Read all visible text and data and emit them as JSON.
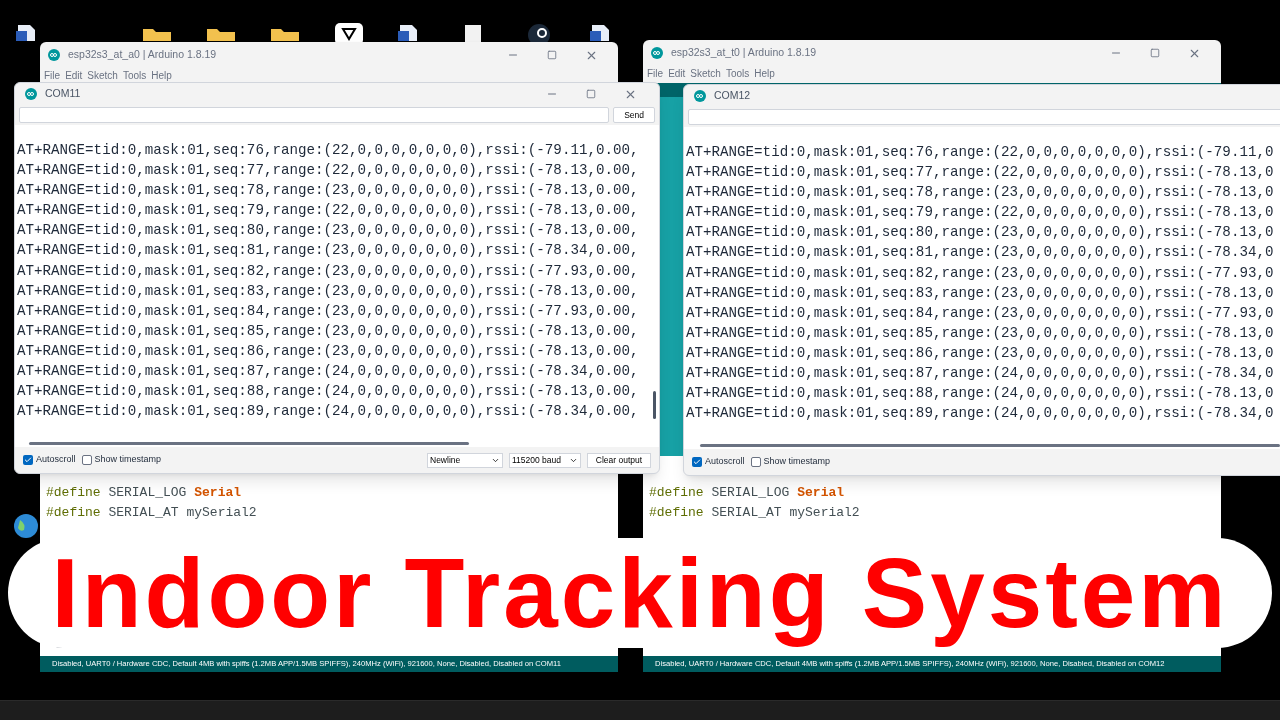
{
  "ide_windows": [
    {
      "title": "esp32s3_at_a0 | Arduino 1.8.19",
      "menu": [
        "File",
        "Edit",
        "Sketch",
        "Tools",
        "Help"
      ],
      "code": [
        [
          {
            "text": "#define",
            "kind": "directive"
          },
          {
            "text": " SERIAL_LOG ",
            "kind": "plain"
          },
          {
            "text": "Serial",
            "kind": "class"
          }
        ],
        [
          {
            "text": "#define",
            "kind": "directive"
          },
          {
            "text": " SERIAL_AT mySerial2",
            "kind": "plain"
          }
        ]
      ],
      "status": "Disabled, UART0 / Hardware CDC, Default 4MB with spiffs (1.2MB APP/1.5MB SPIFFS), 240MHz (WiFi), 921600, None, Disabled, Disabled on COM11"
    },
    {
      "title": "esp32s3_at_t0 | Arduino 1.8.19",
      "menu": [
        "File",
        "Edit",
        "Sketch",
        "Tools",
        "Help"
      ],
      "code": [
        [
          {
            "text": "#define",
            "kind": "directive"
          },
          {
            "text": " SERIAL_LOG ",
            "kind": "plain"
          },
          {
            "text": "Serial",
            "kind": "class"
          }
        ],
        [
          {
            "text": "#define",
            "kind": "directive"
          },
          {
            "text": " SERIAL_AT mySerial2",
            "kind": "plain"
          }
        ]
      ],
      "status": "Disabled, UART0 / Hardware CDC, Default 4MB with spiffs (1.2MB APP/1.5MB SPIFFS), 240MHz (WiFi), 921600, None, Disabled, Disabled on COM12"
    }
  ],
  "monitors": [
    {
      "title": "COM11",
      "send": "Send",
      "lines": [
        "AT+RANGE=tid:0,mask:01,seq:76,range:(22,0,0,0,0,0,0,0),rssi:(-79.11,0.00,",
        "AT+RANGE=tid:0,mask:01,seq:77,range:(22,0,0,0,0,0,0,0),rssi:(-78.13,0.00,",
        "AT+RANGE=tid:0,mask:01,seq:78,range:(23,0,0,0,0,0,0,0),rssi:(-78.13,0.00,",
        "AT+RANGE=tid:0,mask:01,seq:79,range:(22,0,0,0,0,0,0,0),rssi:(-78.13,0.00,",
        "AT+RANGE=tid:0,mask:01,seq:80,range:(23,0,0,0,0,0,0,0),rssi:(-78.13,0.00,",
        "AT+RANGE=tid:0,mask:01,seq:81,range:(23,0,0,0,0,0,0,0),rssi:(-78.34,0.00,",
        "AT+RANGE=tid:0,mask:01,seq:82,range:(23,0,0,0,0,0,0,0),rssi:(-77.93,0.00,",
        "AT+RANGE=tid:0,mask:01,seq:83,range:(23,0,0,0,0,0,0,0),rssi:(-78.13,0.00,",
        "AT+RANGE=tid:0,mask:01,seq:84,range:(23,0,0,0,0,0,0,0),rssi:(-77.93,0.00,",
        "AT+RANGE=tid:0,mask:01,seq:85,range:(23,0,0,0,0,0,0,0),rssi:(-78.13,0.00,",
        "AT+RANGE=tid:0,mask:01,seq:86,range:(23,0,0,0,0,0,0,0),rssi:(-78.13,0.00,",
        "AT+RANGE=tid:0,mask:01,seq:87,range:(24,0,0,0,0,0,0,0),rssi:(-78.34,0.00,",
        "AT+RANGE=tid:0,mask:01,seq:88,range:(24,0,0,0,0,0,0,0),rssi:(-78.13,0.00,",
        "AT+RANGE=tid:0,mask:01,seq:89,range:(24,0,0,0,0,0,0,0),rssi:(-78.34,0.00,"
      ],
      "autoscroll": {
        "label": "Autoscroll",
        "checked": true
      },
      "timestamp": {
        "label": "Show timestamp",
        "checked": false
      },
      "line_ending": "Newline",
      "baud": "115200 baud",
      "clear": "Clear output"
    },
    {
      "title": "COM12",
      "lines": [
        "AT+RANGE=tid:0,mask:01,seq:76,range:(22,0,0,0,0,0,0,0),rssi:(-79.11,0",
        "AT+RANGE=tid:0,mask:01,seq:77,range:(22,0,0,0,0,0,0,0),rssi:(-78.13,0",
        "AT+RANGE=tid:0,mask:01,seq:78,range:(23,0,0,0,0,0,0,0),rssi:(-78.13,0",
        "AT+RANGE=tid:0,mask:01,seq:79,range:(22,0,0,0,0,0,0,0),rssi:(-78.13,0",
        "AT+RANGE=tid:0,mask:01,seq:80,range:(23,0,0,0,0,0,0,0),rssi:(-78.13,0",
        "AT+RANGE=tid:0,mask:01,seq:81,range:(23,0,0,0,0,0,0,0),rssi:(-78.34,0",
        "AT+RANGE=tid:0,mask:01,seq:82,range:(23,0,0,0,0,0,0,0),rssi:(-77.93,0",
        "AT+RANGE=tid:0,mask:01,seq:83,range:(23,0,0,0,0,0,0,0),rssi:(-78.13,0",
        "AT+RANGE=tid:0,mask:01,seq:84,range:(23,0,0,0,0,0,0,0),rssi:(-77.93,0",
        "AT+RANGE=tid:0,mask:01,seq:85,range:(23,0,0,0,0,0,0,0),rssi:(-78.13,0",
        "AT+RANGE=tid:0,mask:01,seq:86,range:(23,0,0,0,0,0,0,0),rssi:(-78.13,0",
        "AT+RANGE=tid:0,mask:01,seq:87,range:(24,0,0,0,0,0,0,0),rssi:(-78.34,0",
        "AT+RANGE=tid:0,mask:01,seq:88,range:(24,0,0,0,0,0,0,0),rssi:(-78.13,0",
        "AT+RANGE=tid:0,mask:01,seq:89,range:(24,0,0,0,0,0,0,0),rssi:(-78.34,0"
      ],
      "autoscroll": {
        "label": "Autoscroll",
        "checked": true
      },
      "timestamp": {
        "label": "Show timestamp",
        "checked": false
      }
    }
  ],
  "banner": "Indoor Tracking System"
}
